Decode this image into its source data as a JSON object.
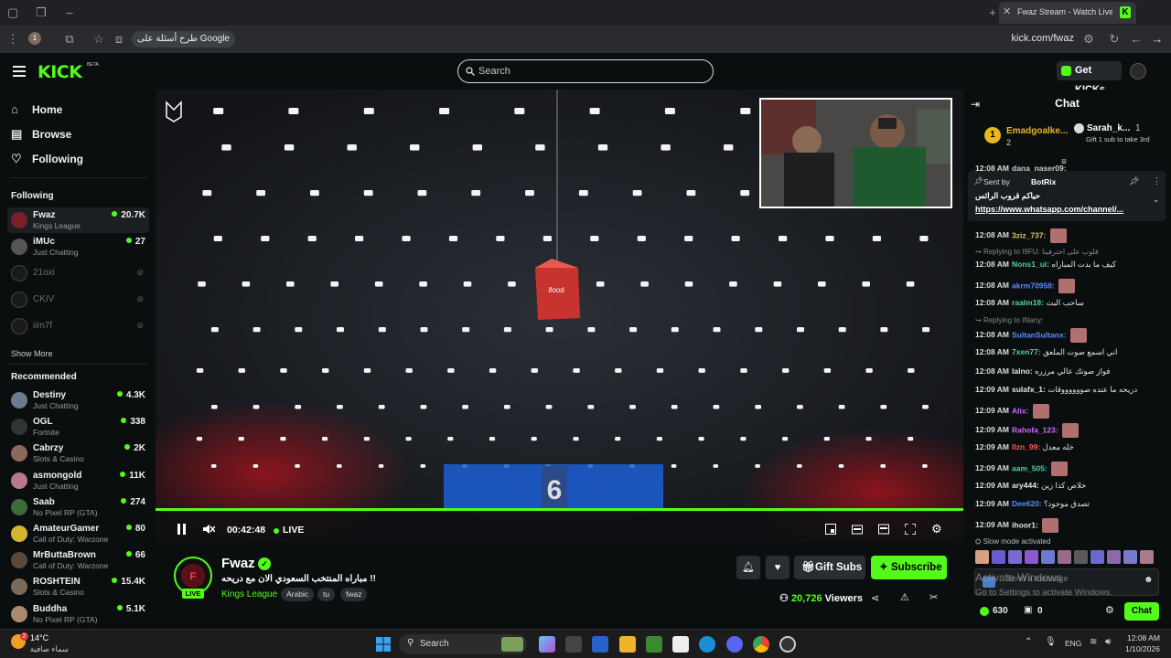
{
  "browser": {
    "tab_title": "Fwaz Stream - Watch Live on Kick",
    "google_chip": "طرح أسئلة على Google",
    "url": "kick.com/fwaz"
  },
  "header": {
    "logo": "KICK",
    "logo_badge": "BETA",
    "search_placeholder": "Search",
    "get_kicks": "Get KICKs"
  },
  "sidebar": {
    "nav": [
      {
        "label": "Home",
        "icon": "home-icon"
      },
      {
        "label": "Browse",
        "icon": "browse-icon"
      },
      {
        "label": "Following",
        "icon": "heart-icon"
      }
    ],
    "following_title": "Following",
    "following": [
      {
        "name": "Fwaz",
        "game": "Kings League",
        "viewers": "20.7K",
        "live": true,
        "color": "#7a1f2a"
      },
      {
        "name": "iMUc",
        "game": "Just Chatting",
        "viewers": "27",
        "live": true,
        "color": "#555"
      },
      {
        "name": "21oxi",
        "live": false
      },
      {
        "name": "CKIV",
        "live": false
      },
      {
        "name": "iim7f",
        "live": false
      }
    ],
    "show_more": "Show More",
    "recommended_title": "Recommended",
    "recommended": [
      {
        "name": "Destiny",
        "game": "Just Chatting",
        "viewers": "4.3K",
        "color": "#6a7d8f"
      },
      {
        "name": "OGL",
        "game": "Fortnite",
        "viewers": "338",
        "color": "#333"
      },
      {
        "name": "Cabrzy",
        "game": "Slots & Casino",
        "viewers": "2K",
        "color": "#8a6a5a"
      },
      {
        "name": "asmongold",
        "game": "Just Chatting",
        "viewers": "11K",
        "color": "#b87a8a"
      },
      {
        "name": "Saab",
        "game": "No Pixel RP (GTA)",
        "viewers": "274",
        "color": "#3d6b3a"
      },
      {
        "name": "AmateurGamer",
        "game": "Call of Duty: Warzone",
        "viewers": "80",
        "color": "#d6b430"
      },
      {
        "name": "MrButtaBrown",
        "game": "Call of Duty: Warzone",
        "viewers": "66",
        "color": "#5a4a3a"
      },
      {
        "name": "ROSHTEIN",
        "game": "Slots & Casino",
        "viewers": "15.4K",
        "color": "#7a6a5a"
      },
      {
        "name": "Buddha",
        "game": "No Pixel RP (GTA)",
        "viewers": "5.1K",
        "color": "#a88a70"
      }
    ]
  },
  "player": {
    "time": "00:42:48",
    "live": "LIVE",
    "progress": 1.0
  },
  "stream": {
    "name": "Fwaz",
    "title": "مباراه المنتخب السعودي الان مع دريحه !!",
    "category": "Kings League",
    "tags": [
      "Arabic",
      "tu",
      "fwaz"
    ],
    "live_badge": "LIVE",
    "gift_subs": "Gift Subs",
    "subscribe": "Subscribe",
    "viewers": "20,726",
    "viewers_label": "Viewers"
  },
  "chat": {
    "title": "Chat",
    "gifters": [
      {
        "rank": "1",
        "name": "Emadgoalke...",
        "count": "2"
      },
      {
        "name": "Sarah_k...",
        "count": "1",
        "note": "Gift 1 sub to take 3rd"
      }
    ],
    "pinned": {
      "sent_by": "Sent by",
      "bot": "BotRix",
      "text": "حياكم قروب الرائس",
      "link": "https://www.whatsapp.com/channel/..."
    },
    "partial_top": {
      "time": "12:08 AM",
      "user": "dana_naser09:",
      "text": "..."
    },
    "messages": [
      {
        "time": "12:08 AM",
        "user": "3ziz_737:",
        "text": "",
        "emote": true,
        "color": "#d9c65a"
      },
      {
        "reply": "Replying to I9FU: قلوب على اخترفينا"
      },
      {
        "time": "12:08 AM",
        "user": "Nons1_ui:",
        "text": "كيف ما بدت المباراه",
        "color": "#4fd1a0"
      },
      {
        "time": "12:08 AM",
        "user": "akrm70958:",
        "text": "",
        "emote": true,
        "color": "#5b8cff"
      },
      {
        "time": "12:08 AM",
        "user": "raalm18:",
        "text": "ساحب البث",
        "color": "#4fd1a0"
      },
      {
        "reply": "Replying to INany:"
      },
      {
        "time": "12:08 AM",
        "user": "SultanSultanx:",
        "text": "",
        "emote": true,
        "color": "#5b8cff"
      },
      {
        "time": "12:08 AM",
        "user": "7xen77:",
        "text": "اني اسمع صوت الملعق",
        "color": "#4fd1a0"
      },
      {
        "time": "12:08 AM",
        "user": "lalno:",
        "text": "فواز صوتك عالي مرزره",
        "color": "#e5e5e5"
      },
      {
        "time": "12:09 AM",
        "user": "sulafx_1:",
        "text": "دريحه ما عنده صووووووقات",
        "color": "#e5e5e5"
      },
      {
        "time": "12:09 AM",
        "user": "Alix:",
        "text": "",
        "emote": true,
        "color": "#c86bff"
      },
      {
        "time": "12:09 AM",
        "user": "Rahofa_123:",
        "text": "",
        "emote": true,
        "color": "#c86bff"
      },
      {
        "time": "12:09 AM",
        "user": "llzn_99:",
        "text": "خله معدل",
        "color": "#ff5a5a"
      },
      {
        "time": "12:09 AM",
        "user": "aam_505:",
        "text": "",
        "emote": true,
        "color": "#4fd1a0"
      },
      {
        "time": "12:09 AM",
        "user": "ary444:",
        "text": "خلاص كذا زين",
        "color": "#e5e5e5"
      },
      {
        "time": "12:09 AM",
        "user": "Dee620:",
        "text": "تصدق موجود؟",
        "color": "#5b8cff"
      },
      {
        "time": "12:09 AM",
        "user": "ihoor1:",
        "text": "",
        "emote": true,
        "color": "#e5e5e5"
      }
    ],
    "slow_mode": "Slow mode activated",
    "input_placeholder": "Send a message",
    "activate_title": "Activate Windows",
    "activate_sub": "Go to Settings to activate Windows.",
    "kicks": "630",
    "gifts": "0",
    "chat_button": "Chat"
  },
  "taskbar": {
    "temperature": "14°C",
    "weather": "سماء صافية",
    "search": "Search",
    "lang": "ENG",
    "time": "12:08 AM",
    "date": "1/10/2026",
    "notif": "2"
  }
}
